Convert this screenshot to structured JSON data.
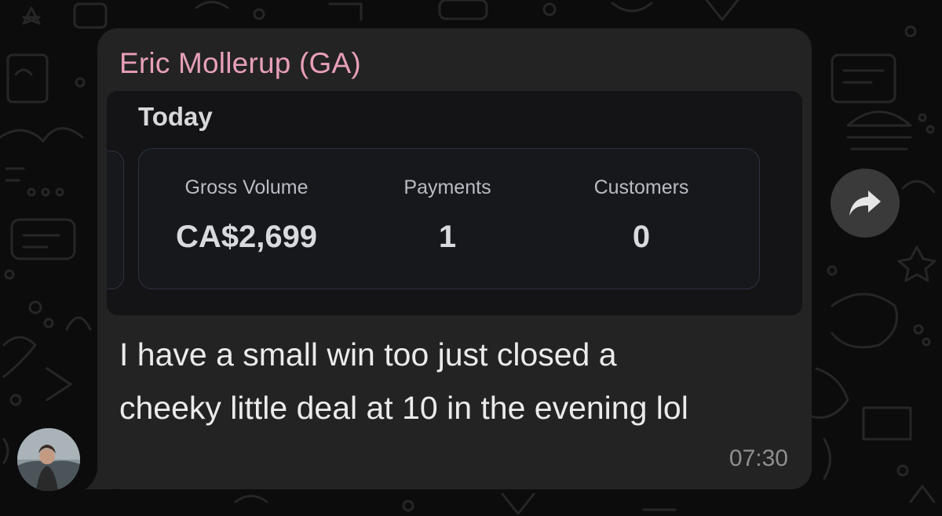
{
  "message": {
    "sender": "Eric Mollerup (GA)",
    "text_lines": [
      "I have a small win too just closed a",
      "cheeky little deal at 10 in the evening lol"
    ],
    "time": "07:30"
  },
  "stats_card": {
    "title": "Today",
    "stats": [
      {
        "label": "Gross Volume",
        "value": "CA$2,699"
      },
      {
        "label": "Payments",
        "value": "1"
      },
      {
        "label": "Customers",
        "value": "0"
      }
    ]
  },
  "icons": {
    "forward": "forward-arrow-icon",
    "avatar": "user-avatar"
  },
  "colors": {
    "sender_name": "#e79fba",
    "bubble": "#232323",
    "background": "#0c0c0c"
  }
}
